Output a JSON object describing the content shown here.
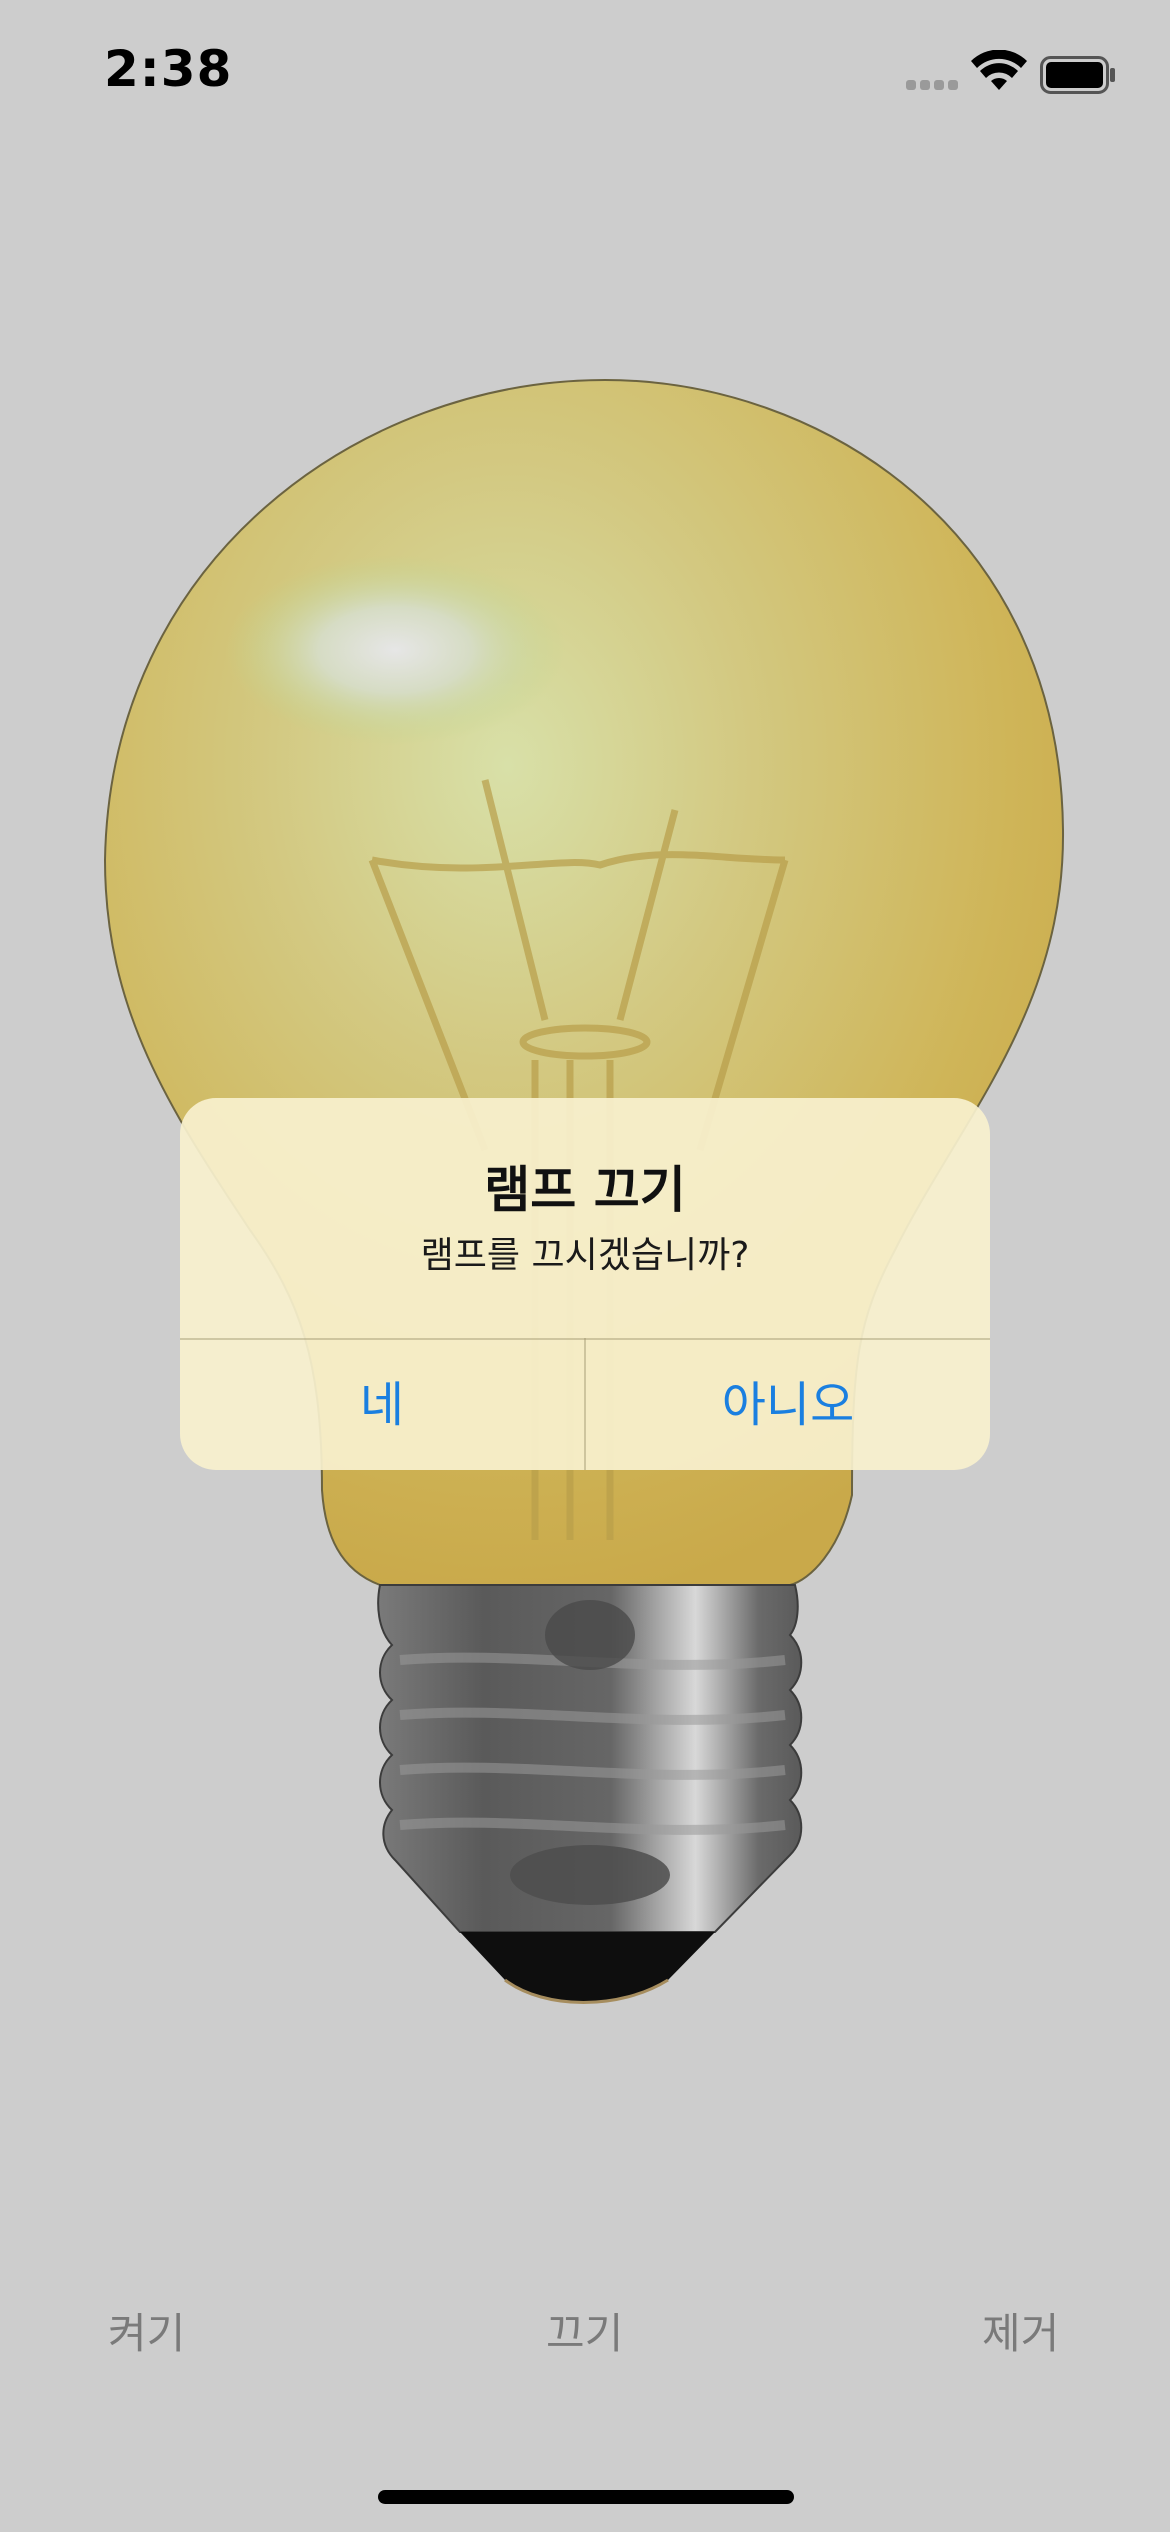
{
  "status_bar": {
    "time": "2:38",
    "icons": [
      "cellular-signal-icon",
      "wifi-icon",
      "battery-icon"
    ]
  },
  "illustration": {
    "name": "light-bulb",
    "state": "off",
    "colors": {
      "glass": "#cfb352",
      "base": "#5e5e5e",
      "tip": "#111111"
    }
  },
  "dialog": {
    "title": "램프 끄기",
    "message": "램프를 끄시겠습니까?",
    "yes_label": "네",
    "no_label": "아니오",
    "button_color": "#1a7fe0"
  },
  "toolbar": {
    "on_label": "켜기",
    "off_label": "끄기",
    "remove_label": "제거"
  }
}
